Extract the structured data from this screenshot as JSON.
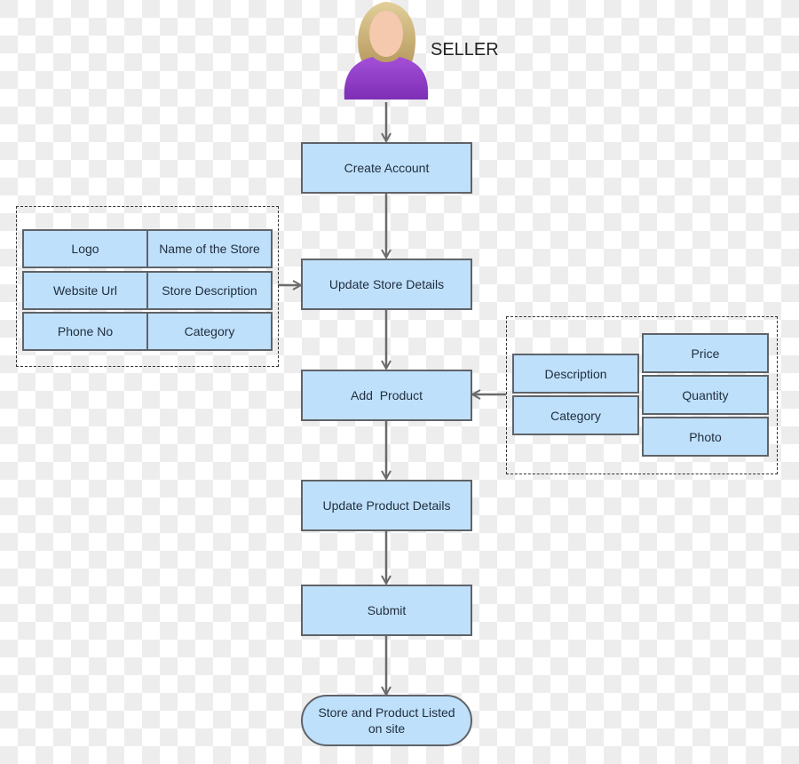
{
  "actor": {
    "label": "SELLER",
    "icon": "female-user-icon"
  },
  "flow": [
    {
      "id": "create-account",
      "label": "Create Account"
    },
    {
      "id": "update-store-details",
      "label": "Update Store Details"
    },
    {
      "id": "add-product",
      "label": "Add  Product"
    },
    {
      "id": "update-product-details",
      "label": "Update Product Details"
    },
    {
      "id": "submit",
      "label": "Submit"
    },
    {
      "id": "listed",
      "label": "Store and Product Listed on site"
    }
  ],
  "store_details_group": {
    "fields": [
      "Logo",
      "Name of the Store",
      "Website Url",
      "Store Description",
      "Phone No",
      "Category"
    ]
  },
  "product_details_group": {
    "left_fields": [
      "Description",
      "Category"
    ],
    "right_fields": [
      "Price",
      "Quantity",
      "Photo"
    ]
  },
  "colors": {
    "box_fill": "#bfe0fb",
    "box_border": "#5f6368",
    "connector": "#6b6b6b"
  }
}
